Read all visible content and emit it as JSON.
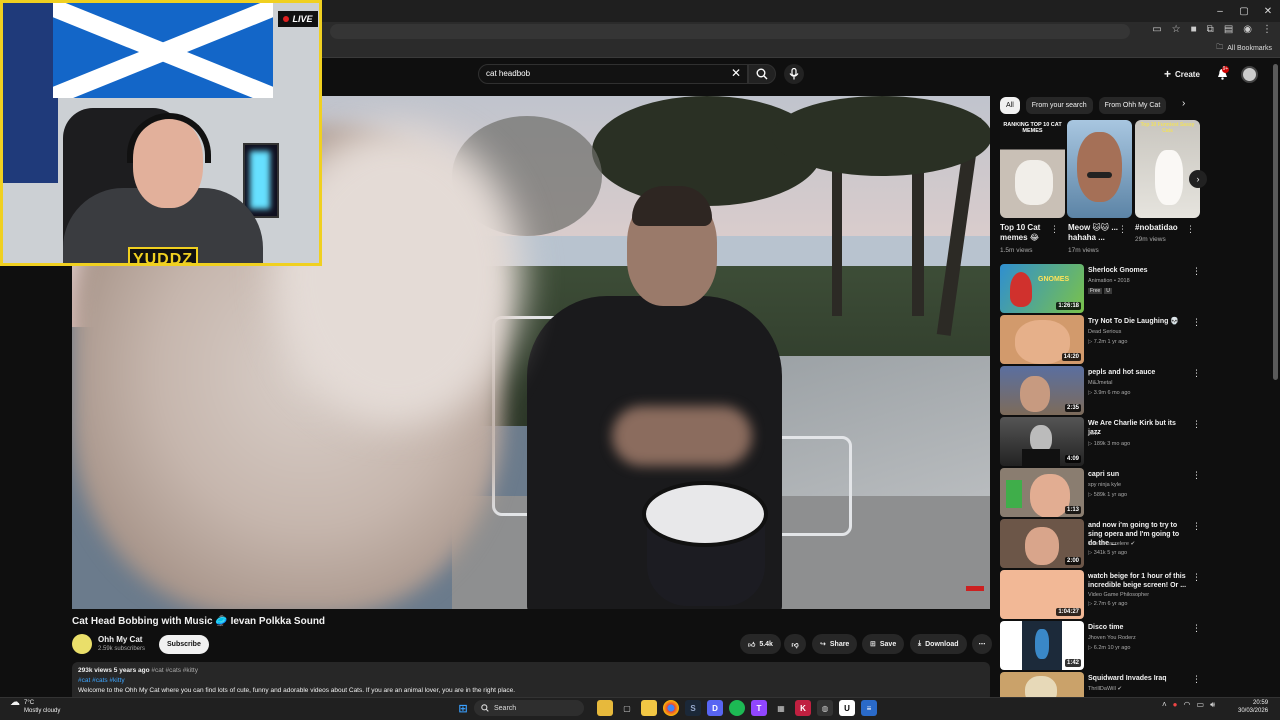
{
  "browser": {
    "window_controls": [
      "–",
      "▢",
      "✕"
    ],
    "bookmarks_label": "All Bookmarks"
  },
  "header": {
    "search_query": "cat headbob",
    "create_label": "Create",
    "notification_count": "9+"
  },
  "webcam": {
    "live_label": "LIVE",
    "logo_text": "YUDDZ"
  },
  "video": {
    "title": "Cat Head Bobbing with Music 🥏 Ievan Polkka Sound",
    "channel_name": "Ohh My Cat",
    "subscribers": "2.59k subscribers",
    "subscribe_label": "Subscribe",
    "likes": "5.4k",
    "share_label": "Share",
    "save_label": "Save",
    "download_label": "Download",
    "views_age": "293k views  5 years ago",
    "hashtags_inline": "#cat #cats #kitty",
    "hashtags_link": "#cat #cats #kitty",
    "description": "Welcome to the Ohh My Cat where you can find lots of cute, funny and adorable videos about Cats. If you are an animal lover, you are in the right place."
  },
  "chips": [
    "All",
    "From your search",
    "From Ohh My Cat"
  ],
  "shorts": [
    {
      "title": "Top 10 Cat memes 😂",
      "views": "1.5m views",
      "banner": "RANKING TOP 10 CAT MEMES"
    },
    {
      "title": "Meow 🐱🐱 ... hahaha ...",
      "views": "17m views",
      "banner": ""
    },
    {
      "title": "#nobatidao",
      "views": "29m views",
      "banner": "Top 10 Funniest Sassy Cats"
    }
  ],
  "recommendations": [
    {
      "title": "Sherlock Gnomes",
      "channel": "Animation • 2018",
      "meta": "Free",
      "duration": "1:26:18",
      "thumb_color": "#2f8fd0"
    },
    {
      "title": "Try Not To Die Laughing 💀",
      "channel": "Dead Serious",
      "meta": "▷ 7.2m  1 yr ago",
      "duration": "14:20",
      "thumb_color": "#cf9a6e"
    },
    {
      "title": "pepls and hot sauce",
      "channel": "M&Jmetal",
      "meta": "▷ 3.9m  6 mo ago",
      "duration": "2:35",
      "thumb_color": "#7d6b5a"
    },
    {
      "title": "We Are Charlie Kirk but its jazz",
      "channel": "Lovr",
      "meta": "▷ 189k  3 mo ago",
      "duration": "4:09",
      "thumb_color": "#3a3a3a"
    },
    {
      "title": "capri sun",
      "channel": "spy ninja kyle",
      "meta": "▷ 589k  1 yr ago",
      "duration": "1:13",
      "thumb_color": "#8a7d70"
    },
    {
      "title": "and now i'm going to try to sing opera and I'm going to do the ...",
      "channel": "Teresa Larzelere ✔",
      "meta": "▷ 341k  5 yr ago",
      "duration": "2:00",
      "thumb_color": "#6c5648"
    },
    {
      "title": "watch beige for 1 hour of this incredible beige screen! Or ...",
      "channel": "Video Game Philosopher",
      "meta": "▷ 2.7m  6 yr ago",
      "duration": "1:04:27",
      "thumb_color": "#f2b896"
    },
    {
      "title": "Disco time",
      "channel": "Jhoven You Roderz",
      "meta": "▷ 6.2m  10 yr ago",
      "duration": "1:42",
      "thumb_color": "#1c2a3a"
    },
    {
      "title": "Squidward Invades Iraq",
      "channel": "ThrillDaWill ✔",
      "meta": "",
      "duration": "",
      "thumb_color": "#caa26a"
    }
  ],
  "taskbar": {
    "temperature": "7°C",
    "weather": "Mostly cloudy",
    "search_label": "Search",
    "time": "20:59",
    "date": "30/03/2026"
  }
}
